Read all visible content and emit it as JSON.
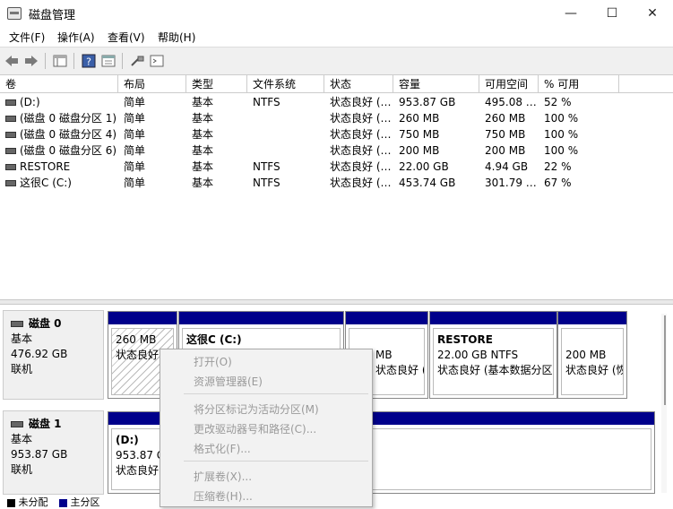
{
  "window": {
    "title": "磁盘管理"
  },
  "menu": [
    "文件(F)",
    "操作(A)",
    "查看(V)",
    "帮助(H)"
  ],
  "volume_table": {
    "columns": [
      "卷",
      "布局",
      "类型",
      "文件系统",
      "状态",
      "容量",
      "可用空间",
      "% 可用"
    ],
    "rows": [
      [
        "(D:)",
        "简单",
        "基本",
        "NTFS",
        "状态良好 (…",
        "953.87 GB",
        "495.08 …",
        "52 %"
      ],
      [
        "(磁盘 0 磁盘分区 1)",
        "简单",
        "基本",
        "",
        "状态良好 (…",
        "260 MB",
        "260 MB",
        "100 %"
      ],
      [
        "(磁盘 0 磁盘分区 4)",
        "简单",
        "基本",
        "",
        "状态良好 (…",
        "750 MB",
        "750 MB",
        "100 %"
      ],
      [
        "(磁盘 0 磁盘分区 6)",
        "简单",
        "基本",
        "",
        "状态良好 (…",
        "200 MB",
        "200 MB",
        "100 %"
      ],
      [
        "RESTORE",
        "简单",
        "基本",
        "NTFS",
        "状态良好 (…",
        "22.00 GB",
        "4.94 GB",
        "22 %"
      ],
      [
        "这很C (C:)",
        "简单",
        "基本",
        "NTFS",
        "状态良好 (…",
        "453.74 GB",
        "301.79 …",
        "67 %"
      ]
    ]
  },
  "disks": {
    "disk0": {
      "name": "磁盘 0",
      "type": "基本",
      "size": "476.92 GB",
      "status": "联机",
      "p1": {
        "size": "260 MB",
        "status": "状态良好"
      },
      "p2": {
        "name": "这很C  (C:)"
      },
      "p3": {
        "size": "MB",
        "status": "状态良好 (恢复"
      },
      "p4": {
        "name": "RESTORE",
        "size": "22.00 GB NTFS",
        "status": "状态良好 (基本数据分区"
      },
      "p5": {
        "size": "200 MB",
        "status": "状态良好 (恢"
      }
    },
    "disk1": {
      "name": "磁盘 1",
      "type": "基本",
      "size": "953.87 GB",
      "status": "联机",
      "p1": {
        "name": "(D:)",
        "size": "953.87 GB",
        "status": "状态良好"
      }
    }
  },
  "context_menu": {
    "open": "打开(O)",
    "explore": "资源管理器(E)",
    "mark_active": "将分区标记为活动分区(M)",
    "change_letter": "更改驱动器号和路径(C)...",
    "format": "格式化(F)...",
    "extend": "扩展卷(X)...",
    "shrink": "压缩卷(H)..."
  },
  "legend": {
    "unallocated": "未分配",
    "primary": "主分区",
    "unallocated_color": "#000000",
    "primary_color": "#00008b"
  }
}
